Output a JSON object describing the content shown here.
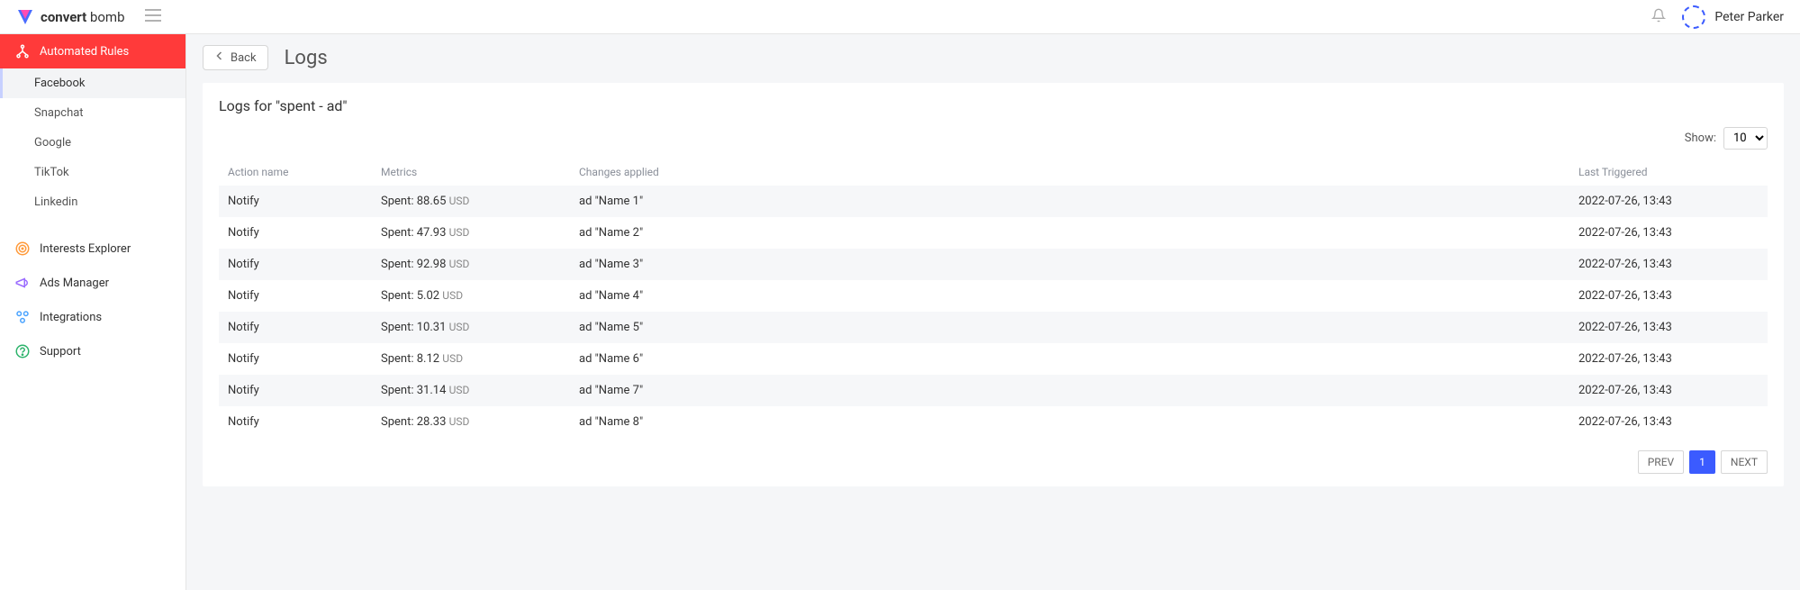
{
  "brand": {
    "strong": "convert",
    "light": " bomb"
  },
  "user": {
    "name": "Peter Parker"
  },
  "sidebar": {
    "automated_rules": "Automated Rules",
    "channels": [
      "Facebook",
      "Snapchat",
      "Google",
      "TikTok",
      "Linkedin"
    ],
    "items": [
      {
        "label": "Interests Explorer"
      },
      {
        "label": "Ads Manager"
      },
      {
        "label": "Integrations"
      },
      {
        "label": "Support"
      }
    ]
  },
  "page": {
    "back": "Back",
    "title": "Logs",
    "panel_title": "Logs for \"spent - ad\"",
    "show_label": "Show:",
    "show_value": "10",
    "columns": {
      "action": "Action name",
      "metrics": "Metrics",
      "changes": "Changes applied",
      "triggered": "Last Triggered"
    },
    "rows": [
      {
        "action": "Notify",
        "metric_label": "Spent:",
        "metric_value": "88.65",
        "metric_currency": "USD",
        "changes": "ad \"Name 1\"",
        "triggered": "2022-07-26, 13:43"
      },
      {
        "action": "Notify",
        "metric_label": "Spent:",
        "metric_value": "47.93",
        "metric_currency": "USD",
        "changes": "ad \"Name 2\"",
        "triggered": "2022-07-26, 13:43"
      },
      {
        "action": "Notify",
        "metric_label": "Spent:",
        "metric_value": "92.98",
        "metric_currency": "USD",
        "changes": "ad \"Name 3\"",
        "triggered": "2022-07-26, 13:43"
      },
      {
        "action": "Notify",
        "metric_label": "Spent:",
        "metric_value": "5.02",
        "metric_currency": "USD",
        "changes": "ad \"Name 4\"",
        "triggered": "2022-07-26, 13:43"
      },
      {
        "action": "Notify",
        "metric_label": "Spent:",
        "metric_value": "10.31",
        "metric_currency": "USD",
        "changes": "ad \"Name 5\"",
        "triggered": "2022-07-26, 13:43"
      },
      {
        "action": "Notify",
        "metric_label": "Spent:",
        "metric_value": "8.12",
        "metric_currency": "USD",
        "changes": "ad \"Name 6\"",
        "triggered": "2022-07-26, 13:43"
      },
      {
        "action": "Notify",
        "metric_label": "Spent:",
        "metric_value": "31.14",
        "metric_currency": "USD",
        "changes": "ad \"Name 7\"",
        "triggered": "2022-07-26, 13:43"
      },
      {
        "action": "Notify",
        "metric_label": "Spent:",
        "metric_value": "28.33",
        "metric_currency": "USD",
        "changes": "ad \"Name 8\"",
        "triggered": "2022-07-26, 13:43"
      }
    ],
    "pager": {
      "prev": "PREV",
      "page": "1",
      "next": "NEXT"
    }
  }
}
